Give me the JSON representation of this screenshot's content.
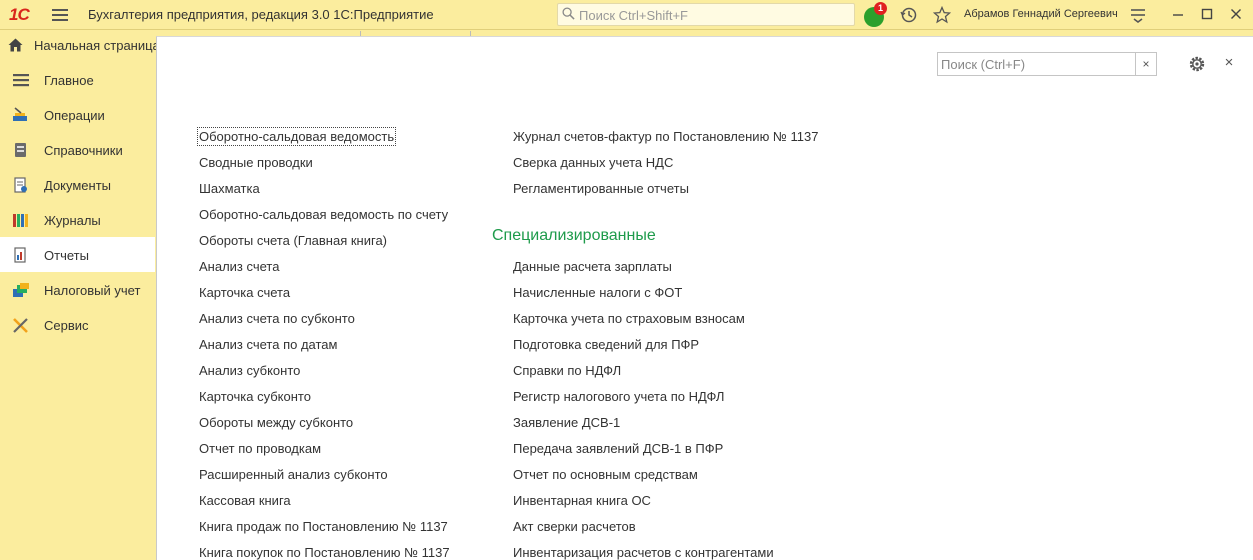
{
  "titlebar": {
    "logo": "1С",
    "app_title": "Бухгалтерия предприятия, редакция 3.0 1С:Предприятие",
    "search_placeholder": "Поиск Ctrl+Shift+F",
    "notification_count": "1",
    "user_name": "Абрамов Геннадий Сергеевич"
  },
  "home_tab": {
    "label": "Начальная страница"
  },
  "sidebar": {
    "items": [
      {
        "label": "Главное",
        "icon": "lines-icon"
      },
      {
        "label": "Операции",
        "icon": "operations-icon"
      },
      {
        "label": "Справочники",
        "icon": "directory-icon"
      },
      {
        "label": "Документы",
        "icon": "document-icon"
      },
      {
        "label": "Журналы",
        "icon": "journals-icon"
      },
      {
        "label": "Отчеты",
        "icon": "reports-icon",
        "active": true
      },
      {
        "label": "Налоговый учет",
        "icon": "tax-icon"
      },
      {
        "label": "Сервис",
        "icon": "tools-icon"
      }
    ]
  },
  "panel": {
    "search_placeholder": "Поиск (Ctrl+F)",
    "clear_glyph": "×",
    "close_glyph": "×",
    "left_column": [
      "Оборотно-сальдовая ведомость",
      "Сводные проводки",
      "Шахматка",
      "Оборотно-сальдовая ведомость по счету",
      "Обороты счета (Главная книга)",
      "Анализ счета",
      "Карточка счета",
      "Анализ счета по субконто",
      "Анализ счета по датам",
      "Анализ субконто",
      "Карточка субконто",
      "Обороты между субконто",
      "Отчет по проводкам",
      "Расширенный анализ субконто",
      "Кассовая книга",
      "Книга продаж по Постановлению № 1137",
      "Книга покупок по Постановлению № 1137"
    ],
    "right_top": [
      "Журнал счетов-фактур по Постановлению № 1137",
      "Сверка данных учета НДС",
      "Регламентированные отчеты"
    ],
    "section_title": "Специализированные",
    "right_section": [
      "Данные расчета зарплаты",
      "Начисленные налоги с ФОТ",
      "Карточка учета по страховым взносам",
      "Подготовка сведений для ПФР",
      "Справки по НДФЛ",
      "Регистр налогового учета по НДФЛ",
      "Заявление ДСВ-1",
      "Передача заявлений ДСВ-1 в ПФР",
      "Отчет по основным средствам",
      "Инвентарная книга ОС",
      "Акт сверки расчетов",
      "Инвентаризация расчетов с контрагентами"
    ]
  },
  "colors": {
    "chrome": "#fbed9e",
    "section": "#1e9b4b",
    "logo": "#d9261c",
    "badge": "#e02020"
  }
}
